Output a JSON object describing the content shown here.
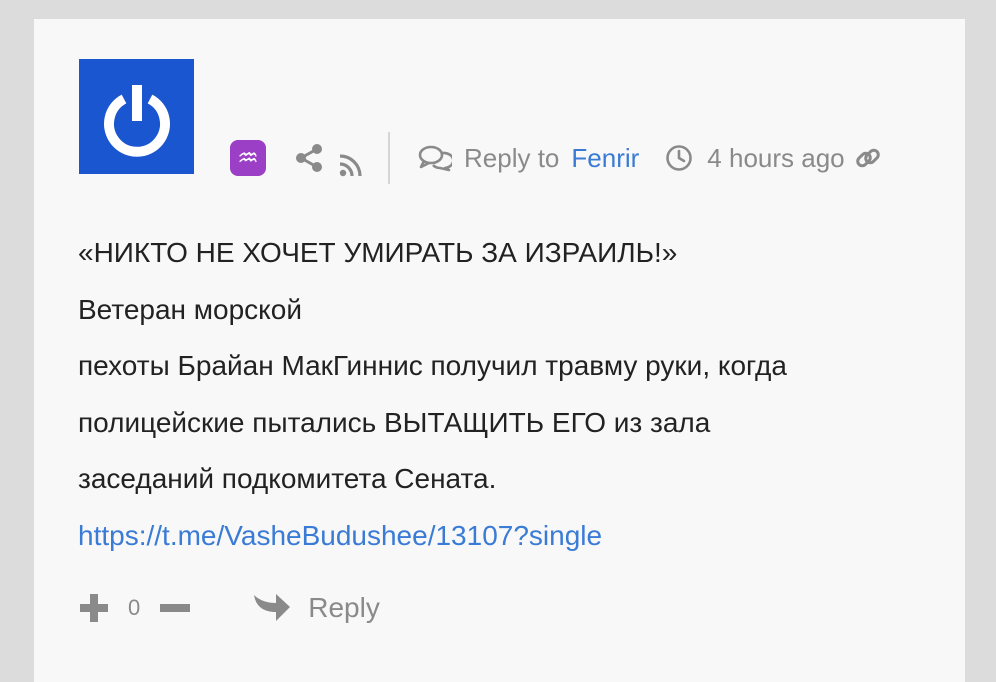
{
  "comment": {
    "avatar_icon": "power-icon",
    "avatar_color": "#1a56cf",
    "zodiac_icon": "aquarius-icon",
    "zodiac_glyph": "♒",
    "zodiac_color": "#9b3fc6",
    "reply_to_label": "Reply to",
    "reply_to_user": "Fenrir",
    "timestamp": "4 hours ago",
    "body_lines": [
      "«НИКТО НЕ ХОЧЕТ УМИРАТЬ ЗА ИЗРАИЛЬ!»",
      "Ветеран морской",
      "пехоты Брайан МакГиннис получил травму руки, когда",
      "полицейские пытались ВЫТАЩИТЬ ЕГО из зала",
      "заседаний подкомитета Сената."
    ],
    "link": "https://t.me/VasheBudushee/13107?single",
    "vote_count": "0",
    "reply_label": "Reply",
    "accent_link_color": "#3a7bd5"
  }
}
